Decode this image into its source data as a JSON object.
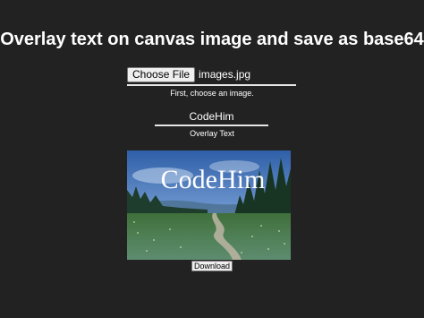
{
  "page": {
    "title": "Overlay text on canvas image and save as base64"
  },
  "file_picker": {
    "button_label": "Choose File",
    "file_name": "images.jpg",
    "hint": "First, choose an image."
  },
  "overlay": {
    "input_value": "CodeHim",
    "label": "Overlay Text"
  },
  "canvas": {
    "overlay_text": "CodeHim"
  },
  "download": {
    "label": "Download"
  },
  "colors": {
    "background": "#222222",
    "text": "#ffffff",
    "underline": "#e6e6e6",
    "button_face": "#efefef"
  }
}
